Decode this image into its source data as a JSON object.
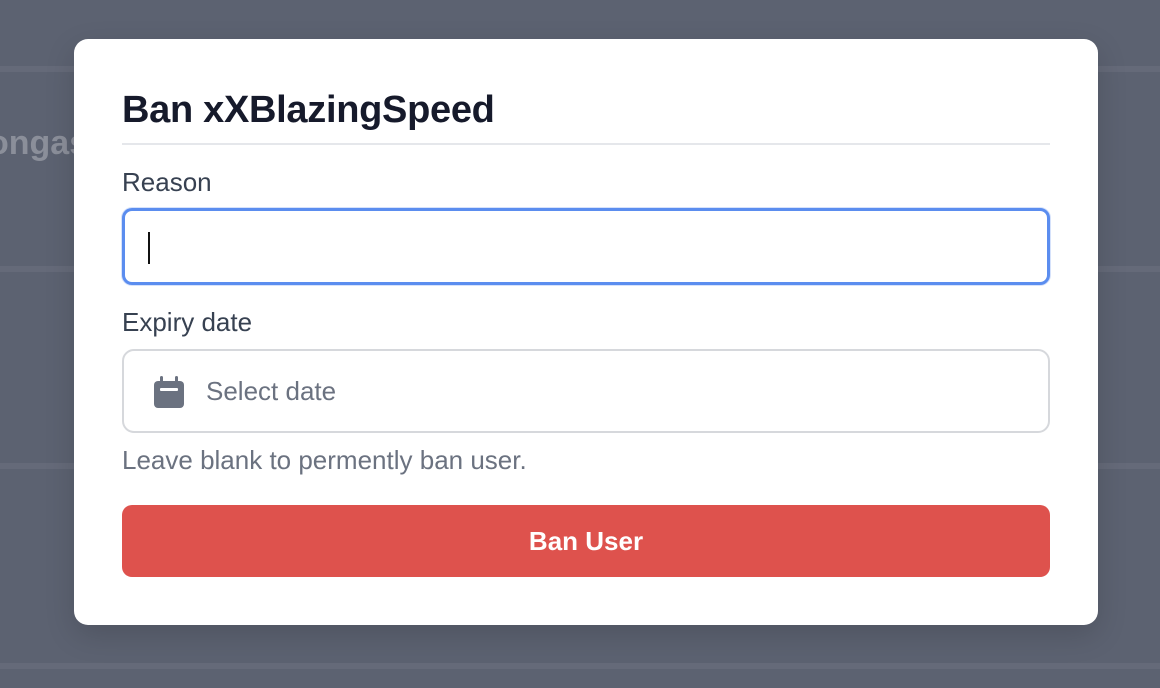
{
  "background": {
    "partial_text": "ongas"
  },
  "modal": {
    "title": "Ban xXBlazingSpeed",
    "reason": {
      "label": "Reason",
      "value": "",
      "focused": true
    },
    "expiry": {
      "label": "Expiry date",
      "placeholder": "Select date",
      "icon": "calendar-icon",
      "help_text": "Leave blank to permently ban user."
    },
    "submit_label": "Ban User"
  },
  "colors": {
    "primary_action": "#de524d",
    "focus_ring": "#5b8def",
    "overlay": "#5b6170"
  }
}
